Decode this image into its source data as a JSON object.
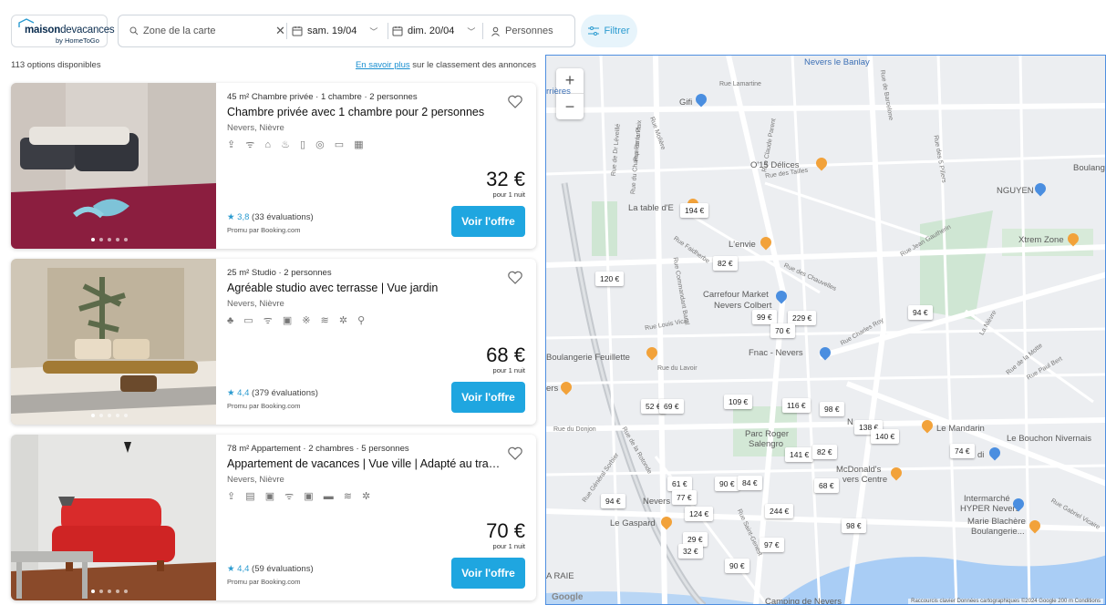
{
  "header": {
    "logo_brand_bold": "maison",
    "logo_brand_rest": "devacances",
    "logo_sub": "by HomeToGo",
    "search": {
      "zone_placeholder": "Zone de la carte",
      "date_from": "sam. 19/04",
      "date_to": "dim. 20/04",
      "persons_placeholder": "Personnes"
    },
    "filter_label": "Filtrer"
  },
  "results": {
    "count_text": "113 options disponibles",
    "ranking_link": "En savoir plus",
    "ranking_suffix": " sur le classement des annonces"
  },
  "listings": [
    {
      "kicker": "45 m² Chambre privée · 1 chambre · 2 personnes",
      "title": "Chambre privée avec 1 chambre pour 2 personnes",
      "location": "Nevers, Nièvre",
      "amenities": "⇪ ᯤ ⌂ ♨ ▯ ◎ ▭ ▦",
      "price": "32 €",
      "per": "pour 1 nuit",
      "rating_score": "3,8",
      "rating_count": "(33 évaluations)",
      "promo": "Promu par Booking.com",
      "offer_label": "Voir l'offre"
    },
    {
      "kicker": "25 m² Studio · 2 personnes",
      "title": "Agréable studio avec terrasse | Vue jardin",
      "location": "Nevers, Nièvre",
      "amenities": "♣ ▭ ᯤ ▣ ※ ≋ ✲ ⚲",
      "price": "68 €",
      "per": "pour 1 nuit",
      "rating_score": "4,4",
      "rating_count": "(379 évaluations)",
      "promo": "Promu par Booking.com",
      "offer_label": "Voir l'offre"
    },
    {
      "kicker": "78 m² Appartement · 2 chambres · 5 personnes",
      "title": "Appartement de vacances | Vue ville | Adapté au travail à ...",
      "location": "Nevers, Nièvre",
      "amenities": "⇪ ▤ ▣ ᯤ ▣ ▬ ≋ ✲",
      "price": "70 €",
      "per": "pour 1 nuit",
      "rating_score": "4,4",
      "rating_count": "(59 évaluations)",
      "promo": "Promu par Booking.com",
      "offer_label": "Voir l'offre"
    }
  ],
  "map": {
    "zoom_in": "+",
    "zoom_out": "−",
    "pins": [
      "194 €",
      "82 €",
      "120 €",
      "99 €",
      "229 €",
      "70 €",
      "94 €",
      "52 €",
      "69 €",
      "109 €",
      "116 €",
      "98 €",
      "138 €",
      "140 €",
      "141 €",
      "82 €",
      "74 €",
      "61 €",
      "90 €",
      "84 €",
      "68 €",
      "94 €",
      "77 €",
      "124 €",
      "244 €",
      "98 €",
      "29 €",
      "32 €",
      "97 €",
      "90 €"
    ],
    "places": {
      "nevers_banlay": "Nevers le Banlay",
      "rrieres": "rrières",
      "gifi": "Gifi",
      "delices": "O'15 Délices",
      "latable": "La table d'E",
      "lenvie": "L'envie",
      "carrefour": "Carrefour Market",
      "carrefour2": "Nevers Colbert",
      "boulangerie": "Boulangerie Feuillette",
      "fnac": "Fnac - Nevers",
      "parc": "Parc Roger",
      "parc2": "Salengro",
      "lemandarin": "Le Mandarin",
      "bouchon": "Le Bouchon Nivernais",
      "mcdo": "McDonald's",
      "mcdo2": "vers Centre",
      "intermarche": "Intermarché",
      "intermarche2": "HYPER Nevers",
      "blachere": "Marie Blachère",
      "blachere2": "Boulangerie...",
      "legaspard": "Le Gaspard",
      "nguyen": "NGUYEN",
      "xtrem": "Xtrem Zone",
      "boulang": "Boulang",
      "nevers": "Nevers",
      "araie": "A RAIE",
      "ers": "ers",
      "camping": "Camping de Nevers",
      "n": "N",
      "di": "di"
    },
    "streets": [
      "Rue Lamartine",
      "Rue de Barcelone",
      "Rue des 5 Piliers",
      "Rue Claude Parent",
      "Rue des Tailles",
      "Rue Faidherbe",
      "Rue des Chauvelles",
      "Rue Louis Vicat",
      "Rue du Lavoir",
      "Rue du Donjon",
      "Rue Jean Gautherin",
      "Rue Paul Bert",
      "Rue de la Motte",
      "Rue Charles Roy",
      "Rue Gabriel Vicaire",
      "La Nièvre",
      "Rue de la Rotonde",
      "Rue Général Sorbier",
      "Rue Saint-Genest",
      "Rue de Dr Léveillé",
      "Rue du Champ Ferrand",
      "Rue de la Paix",
      "Rue Molière",
      "Rue Commandant Baral"
    ],
    "google": "Google",
    "attribution": "Raccourcis clavier   Données cartographiques ©2024 Google   200 m   Conditions"
  }
}
